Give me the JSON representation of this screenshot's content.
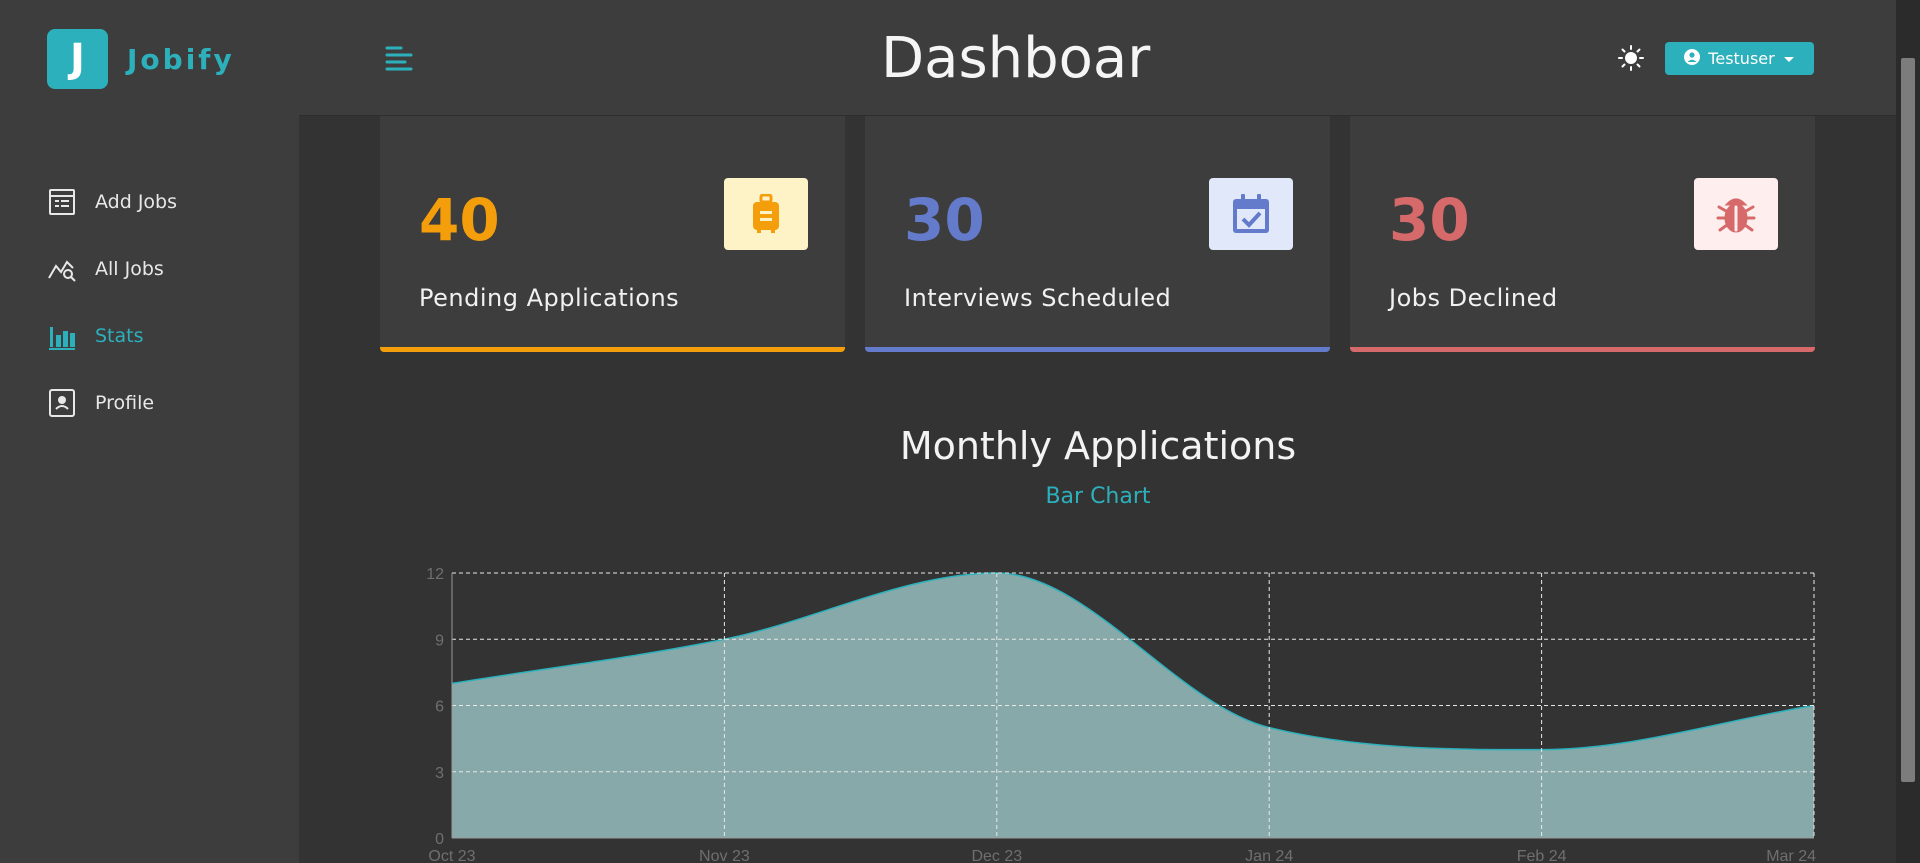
{
  "app": {
    "logo_letter": "J",
    "logo_text": "Jobify"
  },
  "sidebar": {
    "items": [
      {
        "label": "Add Jobs",
        "icon": "add-jobs-icon",
        "active": false
      },
      {
        "label": "All Jobs",
        "icon": "all-jobs-icon",
        "active": false
      },
      {
        "label": "Stats",
        "icon": "stats-icon",
        "active": true
      },
      {
        "label": "Profile",
        "icon": "profile-icon",
        "active": false
      }
    ]
  },
  "header": {
    "title": "Dashboar",
    "user_label": "Testuser"
  },
  "stats": [
    {
      "count": "40",
      "label": "Pending Applications",
      "color": "#f59e0b",
      "icon_bg": "#fef3c7",
      "icon": "suitcase-icon"
    },
    {
      "count": "30",
      "label": "Interviews Scheduled",
      "color": "#647acb",
      "icon_bg": "#e0e8f9",
      "icon": "calendar-check-icon"
    },
    {
      "count": "30",
      "label": "Jobs Declined",
      "color": "#d66a6a",
      "icon_bg": "#ffeeee",
      "icon": "bug-icon"
    }
  ],
  "chart": {
    "title": "Monthly Applications",
    "toggle_label": "Bar Chart"
  },
  "chart_data": {
    "type": "area",
    "categories": [
      "Oct 23",
      "Nov 23",
      "Dec 23",
      "Jan 24",
      "Feb 24",
      "Mar 24"
    ],
    "values": [
      7,
      9,
      12,
      5,
      4,
      6
    ],
    "y_ticks": [
      "0",
      "3",
      "6",
      "9",
      "12"
    ],
    "ylim": [
      0,
      12
    ],
    "grid": true,
    "fill_color": "#87a9aa",
    "line_color": "#2cb1bc"
  },
  "colors": {
    "accent": "#2cb1bc",
    "background": "#333333",
    "panel": "#3d3d3d"
  }
}
